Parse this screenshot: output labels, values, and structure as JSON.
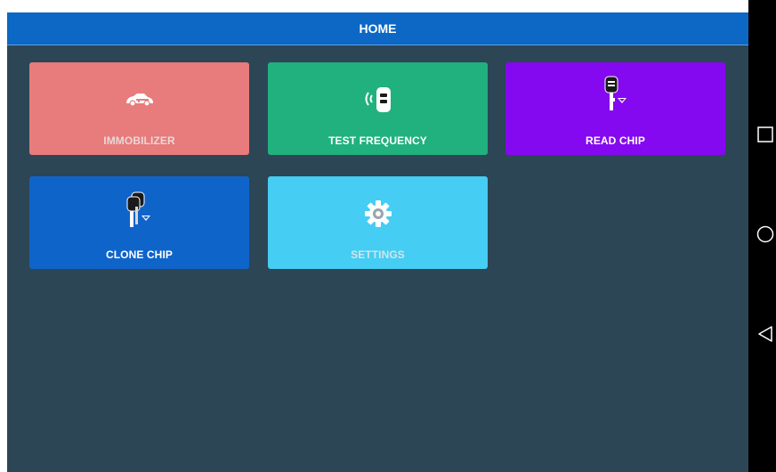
{
  "header": {
    "title": "HOME"
  },
  "tiles": [
    {
      "label": "IMMOBILIZER",
      "icon": "car-key-icon",
      "color": "#e87b7b"
    },
    {
      "label": "TEST FREQUENCY",
      "icon": "key-fob-signal-icon",
      "color": "#20b17f"
    },
    {
      "label": "READ CHIP",
      "icon": "chip-key-icon",
      "color": "#8409f0"
    },
    {
      "label": "CLONE CHIP",
      "icon": "clone-keys-icon",
      "color": "#0f64ca"
    },
    {
      "label": "SETTINGS",
      "icon": "gear-icon",
      "color": "#46cdf3"
    }
  ],
  "colors": {
    "background": "#2c4655",
    "header": "#0c67c5",
    "navbar": "#000000"
  },
  "navbar": {
    "buttons": [
      "recent-apps-icon",
      "home-icon",
      "back-icon"
    ]
  }
}
